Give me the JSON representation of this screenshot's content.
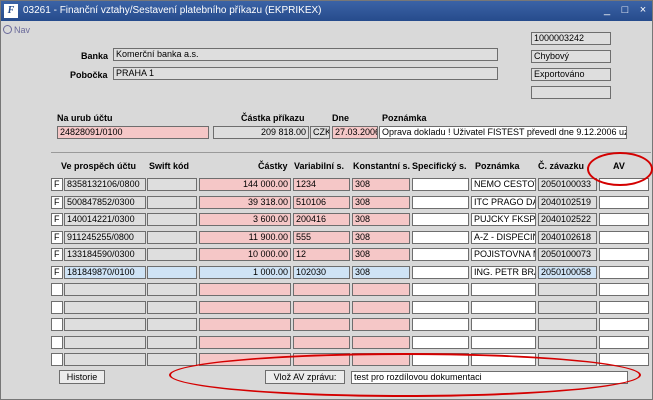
{
  "window": {
    "logo": "F",
    "title": "03261 - Finanční vztahy/Sestavení platebního příkazu (EKPRIKEX)"
  },
  "nav_label": "Nav",
  "banka": {
    "label": "Banka",
    "value": "Komerční banka a.s."
  },
  "pobocka": {
    "label": "Pobočka",
    "value": "PRAHA 1"
  },
  "side_fields": [
    "1000003242",
    "Chybový",
    "Exportováno",
    ""
  ],
  "header": {
    "ucet_label": "Na urub účtu",
    "ucet_value": "24828091/0100",
    "castka_label": "Částka příkazu",
    "castka_value": "209 818.00",
    "mena_value": "CZK",
    "dne_label": "Dne",
    "dne_value": "27.03.2006",
    "poznamka_label": "Poznámka",
    "poznamka_value": "Oprava dokladu ! Uživatel FISTEST převedl dne 9.12.2006 uz"
  },
  "columns": {
    "ucet": "Ve prospěch účtu",
    "swift": "Swift kód",
    "castky": "Částky",
    "vs": "Variabilní s.",
    "ks": "Konstantní s.",
    "ss": "Specifický s.",
    "poznamka": "Poznámka",
    "zavazek": "Č. závazku",
    "av": "AV"
  },
  "rows": [
    {
      "flag": "F",
      "ucet": "8358132106/0800",
      "swift": "",
      "castka": "144 000.00",
      "vs": "1234",
      "ks": "308",
      "ss": "",
      "poznamka": "NEMO CESTOV",
      "zavazek": "2050100033",
      "av": ""
    },
    {
      "flag": "F",
      "ucet": "500847852/0300",
      "swift": "",
      "castka": "39 318.00",
      "vs": "510106",
      "ks": "308",
      "ss": "",
      "poznamka": "ITC PRAGO DA",
      "zavazek": "2040102519",
      "av": ""
    },
    {
      "flag": "F",
      "ucet": "140014221/0300",
      "swift": "",
      "castka": "3 600.00",
      "vs": "200416",
      "ks": "308",
      "ss": "",
      "poznamka": "PUJCKY FKSP-",
      "zavazek": "2040102522",
      "av": ""
    },
    {
      "flag": "F",
      "ucet": "911245255/0800",
      "swift": "",
      "castka": "11 900.00",
      "vs": "555",
      "ks": "308",
      "ss": "",
      "poznamka": "A-Z - DISPECIN",
      "zavazek": "2040102618",
      "av": ""
    },
    {
      "flag": "F",
      "ucet": "133184590/0300",
      "swift": "",
      "castka": "10 000.00",
      "vs": "12",
      "ks": "308",
      "ss": "",
      "poznamka": "POJISTOVNA M",
      "zavazek": "2050100073",
      "av": ""
    },
    {
      "flag": "F",
      "ucet": "181849870/0100",
      "swift": "",
      "castka": "1 000.00",
      "vs": "102030",
      "ks": "308",
      "ss": "",
      "poznamka": "ING. PETR BRAI",
      "zavazek": "2050100058",
      "av": ""
    },
    {
      "flag": "",
      "ucet": "",
      "swift": "",
      "castka": "",
      "vs": "",
      "ks": "",
      "ss": "",
      "poznamka": "",
      "zavazek": "",
      "av": ""
    },
    {
      "flag": "",
      "ucet": "",
      "swift": "",
      "castka": "",
      "vs": "",
      "ks": "",
      "ss": "",
      "poznamka": "",
      "zavazek": "",
      "av": ""
    },
    {
      "flag": "",
      "ucet": "",
      "swift": "",
      "castka": "",
      "vs": "",
      "ks": "",
      "ss": "",
      "poznamka": "",
      "zavazek": "",
      "av": ""
    },
    {
      "flag": "",
      "ucet": "",
      "swift": "",
      "castka": "",
      "vs": "",
      "ks": "",
      "ss": "",
      "poznamka": "",
      "zavazek": "",
      "av": ""
    },
    {
      "flag": "",
      "ucet": "",
      "swift": "",
      "castka": "",
      "vs": "",
      "ks": "",
      "ss": "",
      "poznamka": "",
      "zavazek": "",
      "av": ""
    }
  ],
  "selected_row": 5,
  "footer": {
    "historie_label": "Historie",
    "vloz_label": "Vlož AV zprávu:",
    "zprava_value": "test pro rozdílovou dokumentaci"
  },
  "colors": {
    "title_bar": "#264b8c",
    "required_field": "#f5c7c7",
    "selected_row": "#cfe3f5",
    "annotation": "#d40000"
  }
}
